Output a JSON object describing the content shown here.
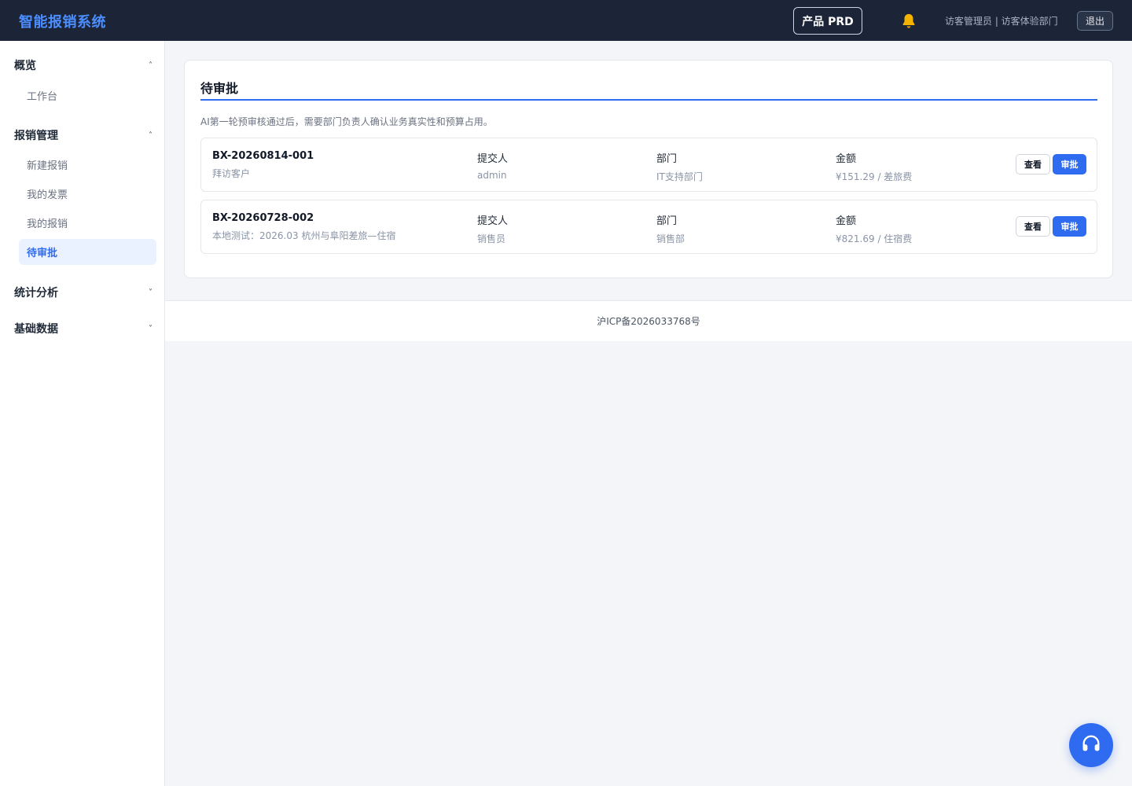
{
  "header": {
    "app_title": "智能报销系统",
    "prd_label": "产品 PRD",
    "bell_icon": "bell-icon",
    "user_info": "访客管理员 | 访客体验部门",
    "logout_label": "退出"
  },
  "sidebar": {
    "groups": [
      {
        "label": "概览",
        "expanded": true,
        "items": [
          {
            "label": "工作台"
          }
        ]
      },
      {
        "label": "报销管理",
        "expanded": true,
        "items": [
          {
            "label": "新建报销"
          },
          {
            "label": "我的发票"
          },
          {
            "label": "我的报销"
          },
          {
            "label": "待审批",
            "active": true
          }
        ]
      },
      {
        "label": "统计分析",
        "expanded": false,
        "items": []
      },
      {
        "label": "基础数据",
        "expanded": false,
        "items": []
      }
    ],
    "chevron_up": "˄",
    "chevron_down": "˅"
  },
  "main": {
    "title": "待审批",
    "description": "AI第一轮预审核通过后，需要部门负责人确认业务真实性和预算占用。",
    "field_labels": {
      "submitter": "提交人",
      "department": "部门",
      "amount": "金额"
    },
    "view_label": "查看",
    "approve_label": "审批",
    "rows": [
      {
        "id": "BX-20260814-001",
        "caption": "拜访客户",
        "submitter": "admin",
        "department": "IT支持部门",
        "amount": "¥151.29 / 差旅费"
      },
      {
        "id": "BX-20260728-002",
        "caption": "本地测试：2026.03 杭州与阜阳差旅—住宿",
        "submitter": "销售员",
        "department": "销售部",
        "amount": "¥821.69 / 住宿费"
      }
    ]
  },
  "footer": {
    "icp": "沪ICP备2026033768号"
  },
  "support": {
    "icon": "headset-icon"
  },
  "colors": {
    "header_bg": "#1c2537",
    "accent": "#2f6bf0",
    "brand_title": "#4c8dff",
    "bell": "#f5b301"
  }
}
